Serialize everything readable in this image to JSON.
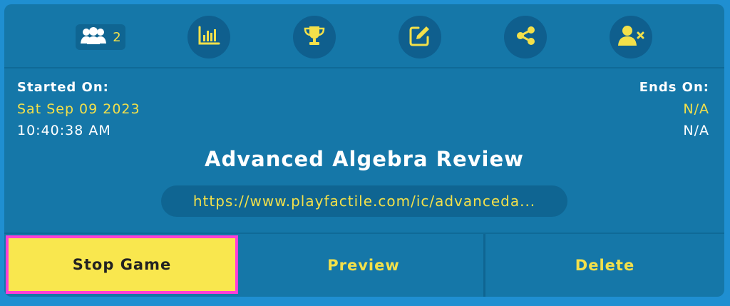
{
  "toolbar": {
    "player_count": "2",
    "icons": [
      "players-icon",
      "stats-icon",
      "trophy-icon",
      "edit-icon",
      "share-icon",
      "remove-user-icon"
    ]
  },
  "started": {
    "label": "Started On:",
    "date": "Sat Sep 09 2023",
    "time": "10:40:38 AM"
  },
  "ends": {
    "label": "Ends On:",
    "date": "N/A",
    "time": "N/A"
  },
  "game": {
    "title": "Advanced Algebra Review",
    "url": "https://www.playfactile.com/ic/advanceda..."
  },
  "actions": {
    "stop": "Stop Game",
    "preview": "Preview",
    "delete": "Delete"
  },
  "colors": {
    "background": "#1f8fd1",
    "card": "#1577a8",
    "accent_yellow": "#f3e04a",
    "stop_button": "#f9e74e",
    "highlight_border": "#ff3fd6"
  }
}
